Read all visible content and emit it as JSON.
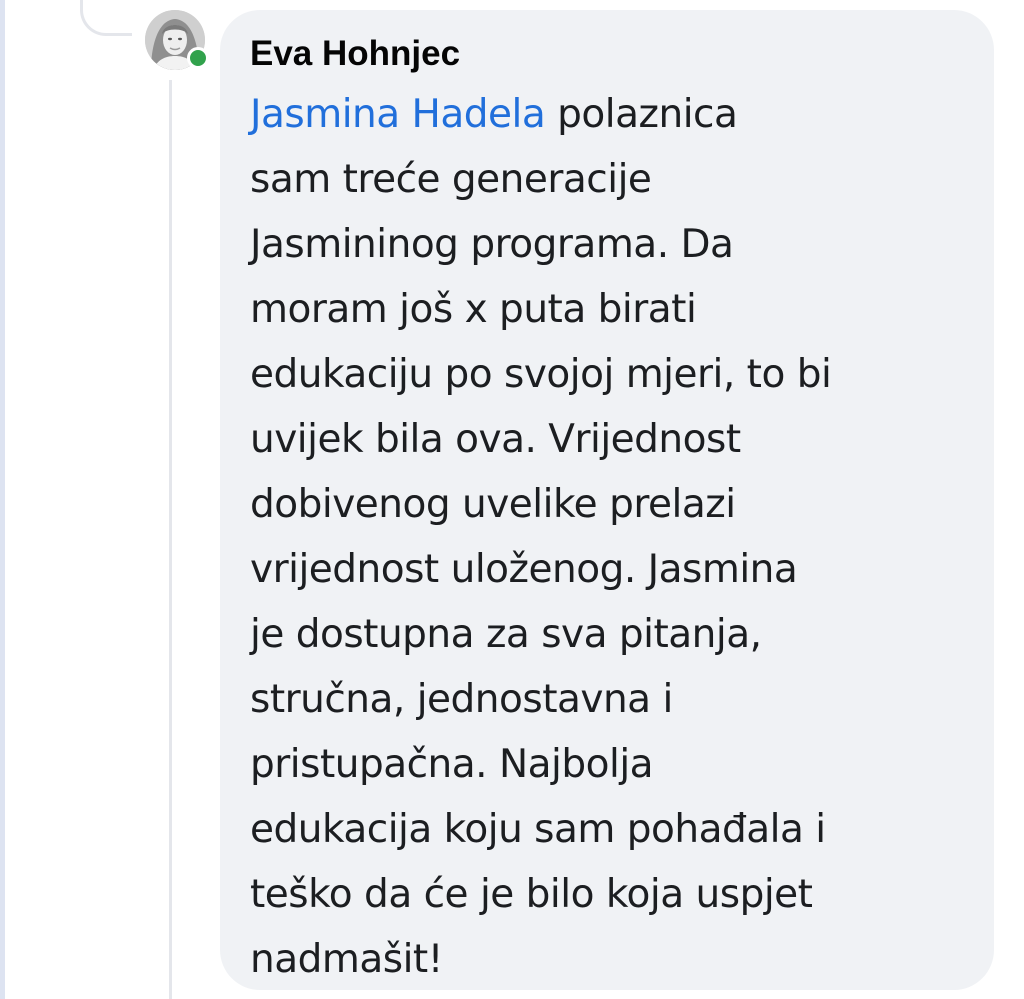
{
  "comment": {
    "author": "Eva Hohnjec",
    "mention": "Jasmina Hadela",
    "lines": [
      " polaznica",
      "sam treće generacije",
      "Jasmininog programa. Da",
      "moram još x puta birati",
      "edukaciju po svojoj mjeri, to bi",
      "uvijek bila ova. Vrijednost",
      "dobivenog uvelike prelazi",
      "vrijednost uloženog. Jasmina",
      "je dostupna za sva pitanja,",
      "stručna, jednostavna i",
      "pristupačna. Najbolja",
      "edukacija koju sam pohađala i",
      "teško da će je bilo koja uspjet",
      "nadmašit!"
    ]
  },
  "colors": {
    "bubble": "#f0f2f5",
    "mention": "#216fdb",
    "text": "#1c1e21",
    "online": "#31a24c"
  },
  "icons": {
    "online_status": "online-status-dot"
  }
}
